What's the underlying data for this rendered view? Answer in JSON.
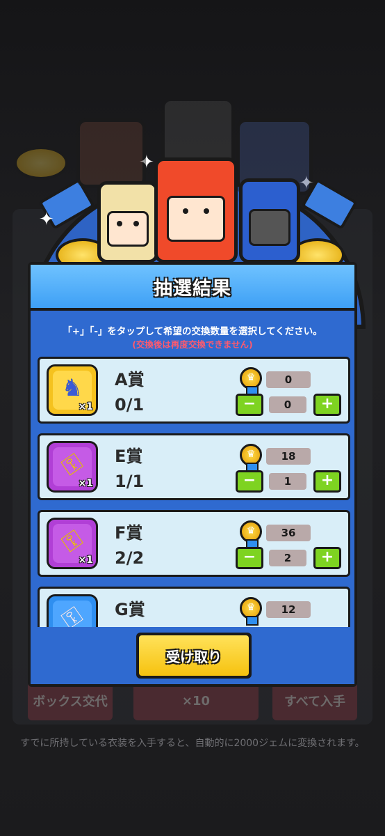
{
  "dialog": {
    "title": "抽選結果",
    "instruction": "「+」「-」をタップして希望の交換数量を選択してください。",
    "warning": "(交換後は再度交換できません)",
    "receive_label": "受け取り"
  },
  "prizes": [
    {
      "name": "A賞",
      "count": "0/1",
      "qty": "×1",
      "cost": "0",
      "amount": "0",
      "icon": "knight-character-icon",
      "color": "gold"
    },
    {
      "name": "E賞",
      "count": "1/1",
      "qty": "×1",
      "cost": "18",
      "amount": "1",
      "icon": "gold-key-icon",
      "color": "purple"
    },
    {
      "name": "F賞",
      "count": "2/2",
      "qty": "×1",
      "cost": "36",
      "amount": "2",
      "icon": "gem-key-icon",
      "color": "purple"
    },
    {
      "name": "G賞",
      "count": "",
      "qty": "",
      "cost": "12",
      "amount": "",
      "icon": "silver-key-icon",
      "color": "blue"
    }
  ],
  "stepper": {
    "minus": "−",
    "plus": "+"
  },
  "background": {
    "box_exchange": "ボックス交代",
    "x10": "×10",
    "get_all": "すべて入手",
    "note": "すでに所持している衣装を入手すると、自動的に2000ジェムに変換されます。"
  },
  "colors": {
    "accent": "#3ea0f5",
    "button_green": "#7ed321",
    "receive_yellow": "#f6c20f",
    "warning_red": "#ff5a6e"
  }
}
